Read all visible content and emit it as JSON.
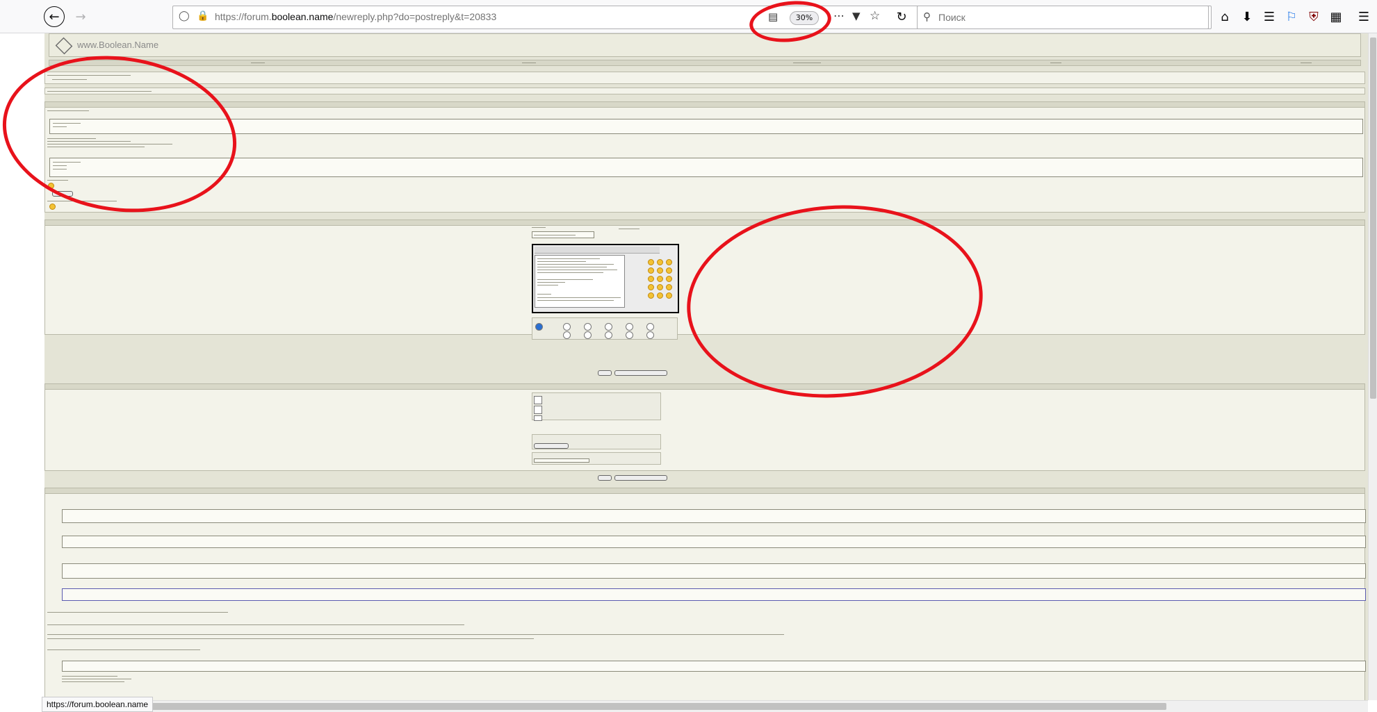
{
  "browser": {
    "url_prefix": "https://forum.",
    "url_domain": "boolean.name",
    "url_path": "/newreply.php?do=postreply&t=20833",
    "zoom": "30%",
    "search_placeholder": "Поиск",
    "status_url": "https://forum.boolean.name"
  },
  "site": {
    "logo_text": "www.Boolean.Name"
  },
  "colors": {
    "annotation": "#e8121b",
    "page_background": "#e4e4d6",
    "panel_background": "#f3f3ea"
  },
  "icons": [
    "back-icon",
    "forward-icon",
    "shield-icon",
    "lock-icon",
    "reader-view-icon",
    "more-icon",
    "pocket-icon",
    "bookmark-star-icon",
    "reload-icon",
    "search-icon",
    "home-icon",
    "download-icon",
    "library-icon",
    "translate-icon",
    "ublock-icon",
    "extensions-icon",
    "menu-icon"
  ]
}
